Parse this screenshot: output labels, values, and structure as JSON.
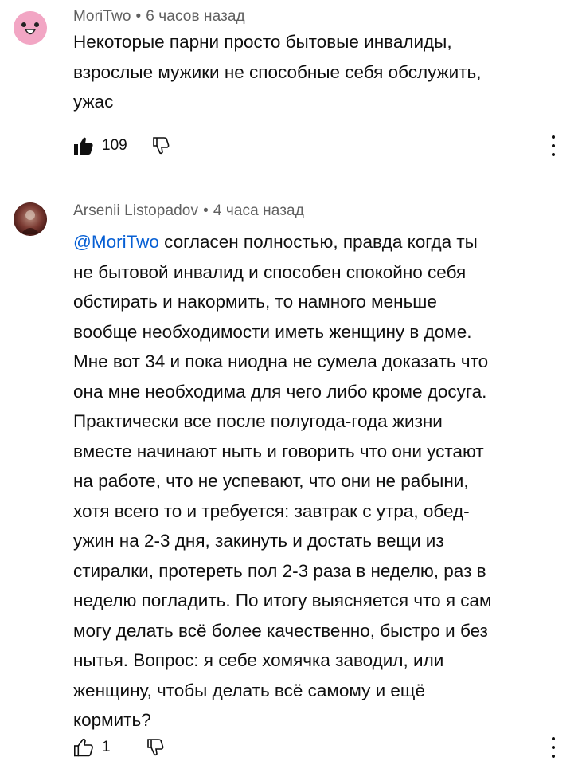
{
  "comments": [
    {
      "author": "MoriTwo",
      "time": "6 часов назад",
      "lines": [
        "Некоторые парни просто бытовые инвалиды,",
        "взрослые мужики не способные себя обслужить,",
        "ужас"
      ],
      "like_count": "109",
      "like_icon": "thumbs-up-filled-icon",
      "dislike_icon": "thumbs-down-outline-icon",
      "avatar_color": "#f2a6c4"
    },
    {
      "author": "Arsenii Listopadov",
      "time": "4 часа назад",
      "mention": "@MoriTwo",
      "first_line_rest": " согласен полностью, правда когда ты",
      "lines": [
        "не бытовой инвалид и способен спокойно себя",
        "обстирать и накормить, то намного меньше",
        "вообще необходимости иметь женщину в доме.",
        "Мне вот 34 и пока ниодна не сумела доказать что",
        "она мне необходима для чего либо кроме досуга.",
        "Практически все после полугода-года жизни",
        "вместе начинают ныть  и говорить что они устают",
        "на работе, что не успевают, что они не рабыни,",
        "хотя всего то и требуется: завтрак с утра, обед-",
        "ужин на 2-3 дня, закинуть и достать вещи из",
        "стиралки, протереть пол 2-3 раза в неделю, раз в",
        "неделю погладить. По итогу выясняется что я сам",
        "могу делать всё более качественно, быстро и без",
        "нытья. Вопрос: я себе хомячка заводил, или",
        "женщину, чтобы делать всё самому и ещё",
        "кормить?"
      ],
      "like_count": "1",
      "like_icon": "thumbs-up-outline-icon",
      "dislike_icon": "thumbs-down-outline-icon",
      "mention_color": "#065fd4"
    }
  ],
  "meta_separator": "•"
}
